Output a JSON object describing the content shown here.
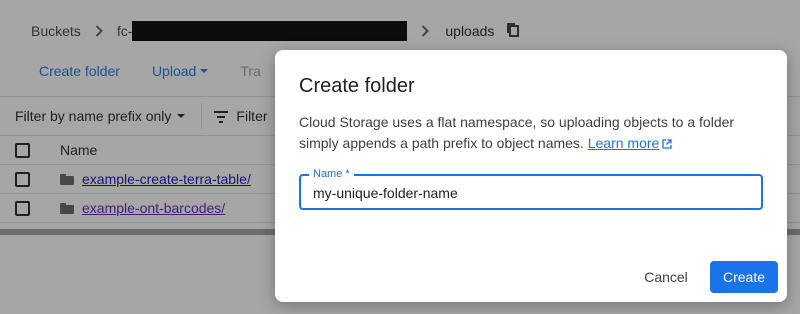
{
  "breadcrumb": {
    "root": "Buckets",
    "bucket_prefix": "fc-",
    "current": "uploads"
  },
  "toolbar": {
    "create_folder": "Create folder",
    "upload": "Upload",
    "transfer_partial": "Tra"
  },
  "filter": {
    "mode": "Filter by name prefix only",
    "filter_label": "Filter"
  },
  "table": {
    "header_name": "Name",
    "rows": [
      {
        "name": "example-create-terra-table/"
      },
      {
        "name": "example-ont-barcodes/"
      }
    ]
  },
  "dialog": {
    "title": "Create folder",
    "description": "Cloud Storage uses a flat namespace, so uploading objects to a folder simply appends a path prefix to object names.",
    "learn_more": "Learn more",
    "field_label": "Name *",
    "field_value": "my-unique-folder-name",
    "cancel": "Cancel",
    "create": "Create"
  },
  "colors": {
    "accent": "#1a73e8",
    "link_visited": "#681da8",
    "link": "#1a0dab",
    "scrim": "rgba(32,33,36,0.4)"
  },
  "icons": [
    "chevron-right-icon",
    "copy-icon",
    "caret-down-icon",
    "filter-icon",
    "folder-icon",
    "external-link-icon"
  ]
}
